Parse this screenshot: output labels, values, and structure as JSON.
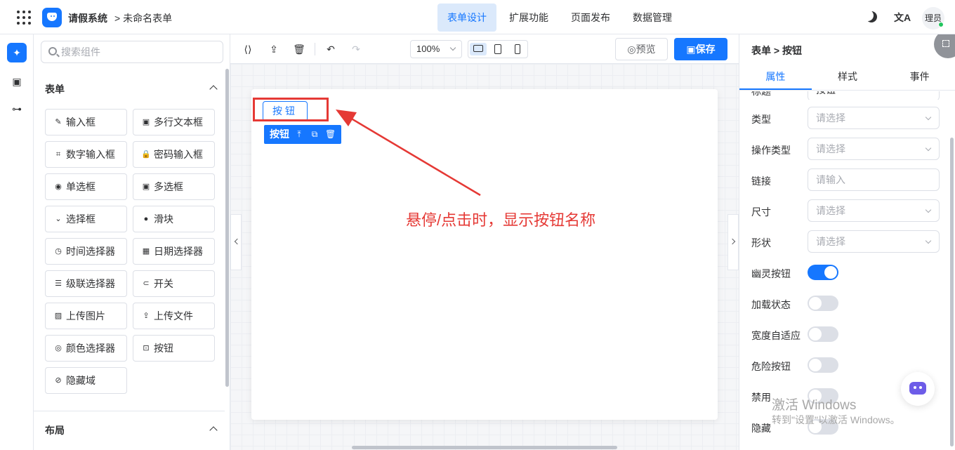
{
  "header": {
    "app_name": "请假系统",
    "breadcrumb": "> 未命名表单",
    "nav": [
      "表单设计",
      "扩展功能",
      "页面发布",
      "数据管理"
    ],
    "active_nav": "表单设计",
    "lang_label": "文A",
    "user_avatar": "理员",
    "accent_color": "#1677ff"
  },
  "rail": {
    "icons": [
      "puzzle-icon",
      "form-icon",
      "flow-icon"
    ]
  },
  "component_panel": {
    "search_placeholder": "搜索组件",
    "section_form": "表单",
    "components": [
      {
        "label": "输入框",
        "icon": "✎"
      },
      {
        "label": "多行文本框",
        "icon": "▣"
      },
      {
        "label": "数字输入框",
        "icon": "⌗"
      },
      {
        "label": "密码输入框",
        "icon": "🔒"
      },
      {
        "label": "单选框",
        "icon": "◉"
      },
      {
        "label": "多选框",
        "icon": "▣"
      },
      {
        "label": "选择框",
        "icon": "⌄"
      },
      {
        "label": "滑块",
        "icon": "●"
      },
      {
        "label": "时间选择器",
        "icon": "◷"
      },
      {
        "label": "日期选择器",
        "icon": "▦"
      },
      {
        "label": "级联选择器",
        "icon": "☰"
      },
      {
        "label": "开关",
        "icon": "⊂"
      },
      {
        "label": "上传图片",
        "icon": "▨"
      },
      {
        "label": "上传文件",
        "icon": "⇪"
      },
      {
        "label": "颜色选择器",
        "icon": "◎"
      },
      {
        "label": "按钮",
        "icon": "⊡"
      },
      {
        "label": "隐藏域",
        "icon": "⊘"
      }
    ],
    "section_layout": "布局"
  },
  "canvas": {
    "zoom": "100%",
    "preview_label": "预览",
    "save_label": "保存",
    "widget_button_text": "按钮",
    "widget_bar_label": "按钮",
    "annotation": "悬停/点击时，显示按钮名称",
    "annotation_color": "#e53935"
  },
  "property_panel": {
    "title": "表单 > 按钮",
    "tabs": [
      "属性",
      "样式",
      "事件"
    ],
    "active_tab": "属性",
    "partial_row": {
      "label": "标题",
      "value": "按钮"
    },
    "rows": [
      {
        "label": "类型",
        "kind": "select",
        "placeholder": "请选择"
      },
      {
        "label": "操作类型",
        "kind": "select",
        "placeholder": "请选择"
      },
      {
        "label": "链接",
        "kind": "input",
        "placeholder": "请输入"
      },
      {
        "label": "尺寸",
        "kind": "select",
        "placeholder": "请选择"
      },
      {
        "label": "形状",
        "kind": "select",
        "placeholder": "请选择"
      },
      {
        "label": "幽灵按钮",
        "kind": "switch",
        "on": true
      },
      {
        "label": "加载状态",
        "kind": "switch",
        "on": false
      },
      {
        "label": "宽度自适应",
        "kind": "switch",
        "on": false
      },
      {
        "label": "危险按钮",
        "kind": "switch",
        "on": false
      },
      {
        "label": "禁用",
        "kind": "switch",
        "on": false
      },
      {
        "label": "隐藏",
        "kind": "switch",
        "on": false
      }
    ]
  },
  "watermark": {
    "line1": "激活 Windows",
    "line2": "转到\"设置\"以激活 Windows。"
  }
}
